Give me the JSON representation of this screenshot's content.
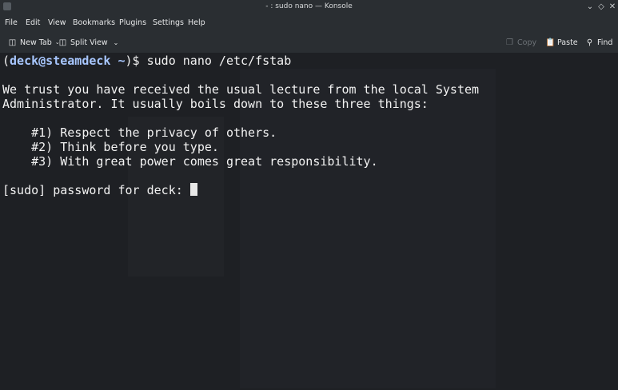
{
  "window": {
    "title": "- : sudo nano — Konsole",
    "buttons": [
      "minimize",
      "maximize",
      "close"
    ]
  },
  "menu": [
    "File",
    "Edit",
    "View",
    "Bookmarks",
    "Plugins",
    "Settings",
    "Help"
  ],
  "toolbar": {
    "new_tab": "New Tab",
    "split_view": "Split View",
    "copy": "Copy",
    "paste": "Paste",
    "find": "Find"
  },
  "terminal": {
    "prompt_open": "(",
    "prompt_user": "deck@steamdeck",
    "prompt_path": " ~",
    "prompt_close": ")$ ",
    "command": "sudo nano /etc/fstab",
    "lecture_1": "We trust you have received the usual lecture from the local System",
    "lecture_2": "Administrator. It usually boils down to these three things:",
    "rule_1": "    #1) Respect the privacy of others.",
    "rule_2": "    #2) Think before you type.",
    "rule_3": "    #3) With great power comes great responsibility.",
    "password_prompt": "[sudo] password for deck: "
  },
  "colors": {
    "background": "#1e2024",
    "prompt": "#a8c7ff",
    "text": "#f2f2f2"
  }
}
